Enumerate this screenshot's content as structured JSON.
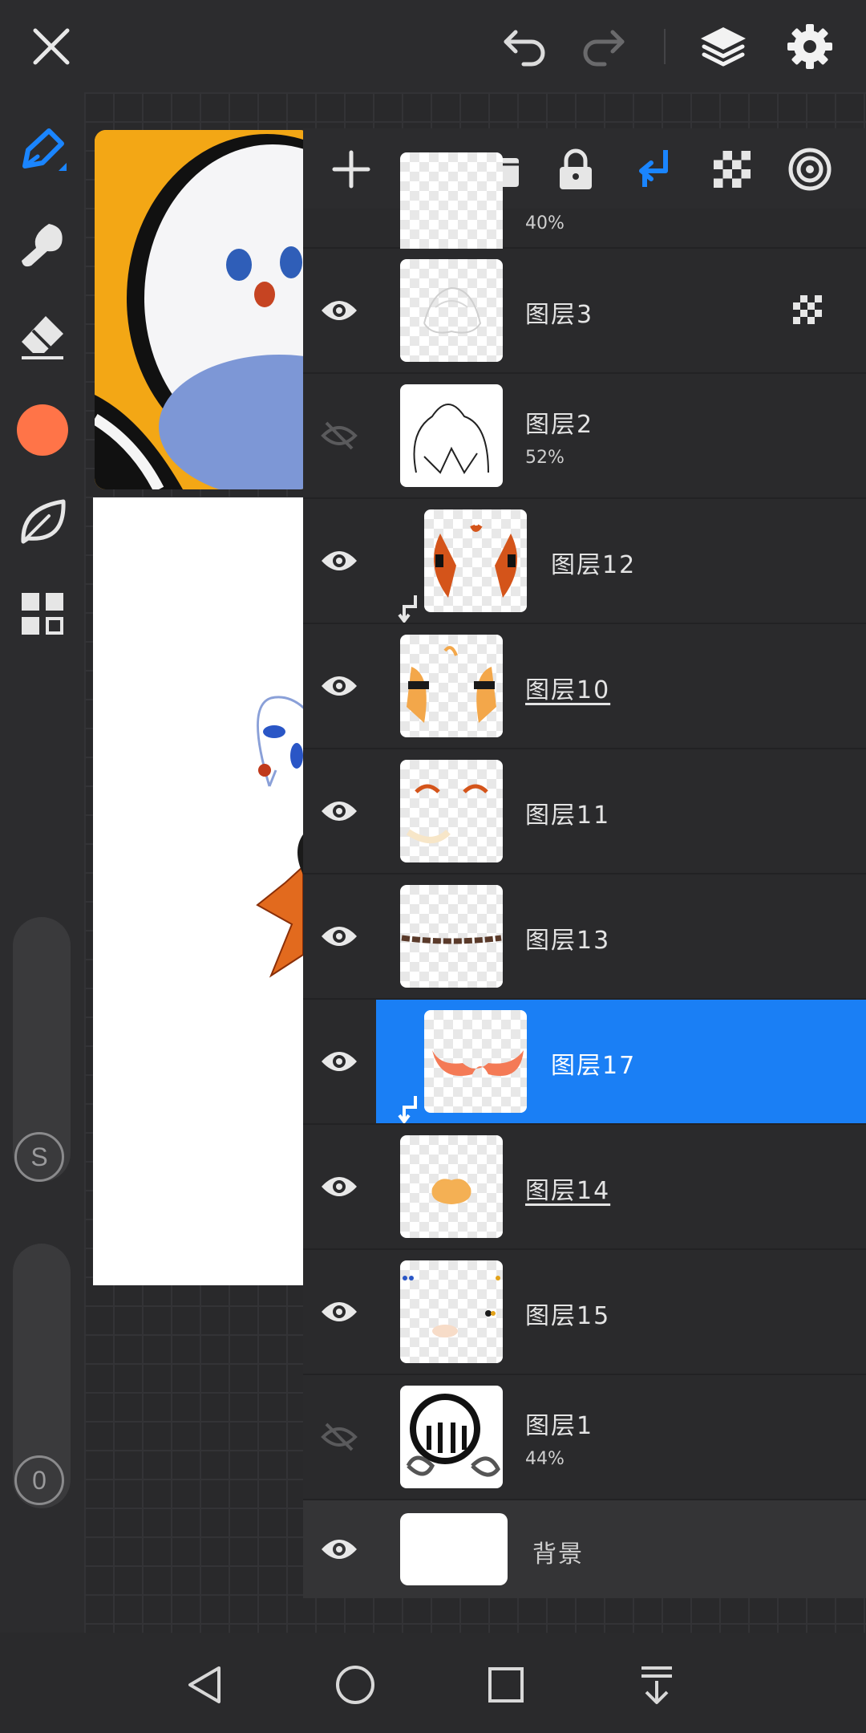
{
  "colors": {
    "accent": "#1a85ff",
    "current_color": "#ff7448",
    "panel_bg": "#2a2a2c",
    "selected_row": "#1a7ff5"
  },
  "top_bar": {
    "icons": [
      "close-icon",
      "undo-icon",
      "redo-icon",
      "layers-icon",
      "settings-icon"
    ]
  },
  "toolbar": {
    "tools": [
      "pen-icon",
      "smudge-icon",
      "eraser-icon",
      "color-swatch",
      "leaf-icon",
      "grid-icon"
    ],
    "size_slider_label": "S",
    "opacity_slider_label": "0"
  },
  "layers_panel": {
    "toolbar_icons": [
      "add-icon",
      "folder-icon",
      "lock-icon",
      "clip-icon",
      "alpha-lock-icon",
      "blend-icon"
    ],
    "partial_top_opacity": "40%",
    "layers": [
      {
        "name": "图层3",
        "opacity": "",
        "visible": true,
        "clipped": false,
        "underlined": false,
        "alpha_lock": true
      },
      {
        "name": "图层2",
        "opacity": "52%",
        "visible": false,
        "clipped": false,
        "underlined": false,
        "alpha_lock": false
      },
      {
        "name": "图层12",
        "opacity": "",
        "visible": true,
        "clipped": true,
        "underlined": false,
        "alpha_lock": false
      },
      {
        "name": "图层10",
        "opacity": "",
        "visible": true,
        "clipped": false,
        "underlined": true,
        "alpha_lock": false
      },
      {
        "name": "图层11",
        "opacity": "",
        "visible": true,
        "clipped": false,
        "underlined": false,
        "alpha_lock": false
      },
      {
        "name": "图层13",
        "opacity": "",
        "visible": true,
        "clipped": false,
        "underlined": false,
        "alpha_lock": false
      },
      {
        "name": "图层17",
        "opacity": "",
        "visible": true,
        "clipped": true,
        "underlined": false,
        "alpha_lock": false,
        "selected": true
      },
      {
        "name": "图层14",
        "opacity": "",
        "visible": true,
        "clipped": false,
        "underlined": true,
        "alpha_lock": false
      },
      {
        "name": "图层15",
        "opacity": "",
        "visible": true,
        "clipped": false,
        "underlined": false,
        "alpha_lock": false
      },
      {
        "name": "图层1",
        "opacity": "44%",
        "visible": false,
        "clipped": false,
        "underlined": false,
        "alpha_lock": false
      },
      {
        "name": "背景",
        "opacity": "",
        "visible": true,
        "clipped": false,
        "underlined": false,
        "alpha_lock": false
      }
    ]
  },
  "navbar": {
    "icons": [
      "back-icon",
      "home-icon",
      "recents-icon",
      "menu-down-icon"
    ]
  }
}
